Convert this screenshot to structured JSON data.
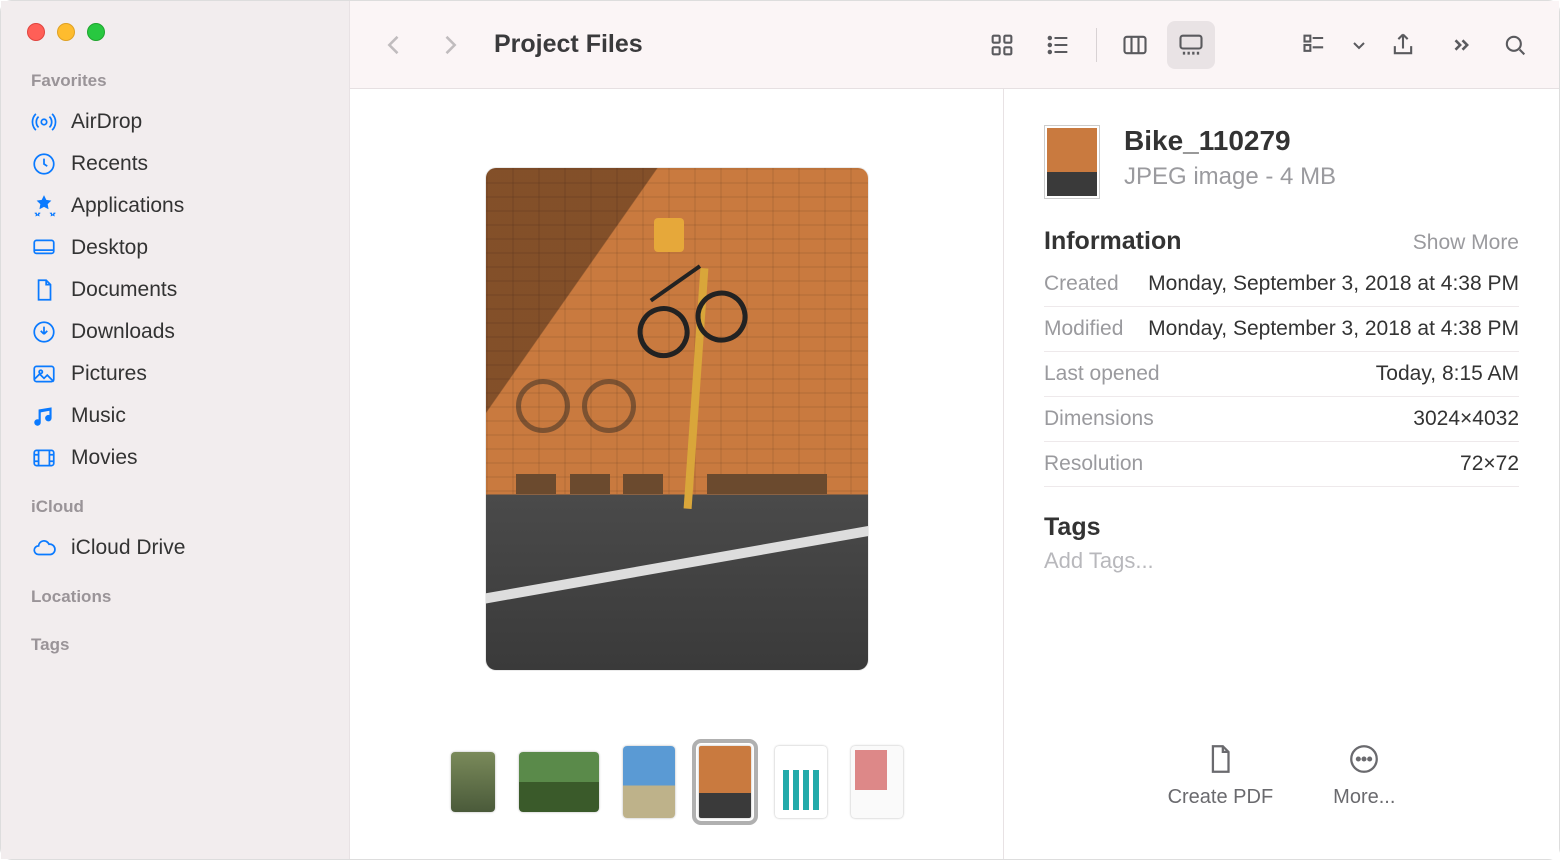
{
  "window": {
    "title": "Project Files"
  },
  "sidebar": {
    "sections": [
      {
        "label": "Favorites",
        "items": [
          {
            "icon": "airdrop",
            "label": "AirDrop"
          },
          {
            "icon": "recents",
            "label": "Recents"
          },
          {
            "icon": "applications",
            "label": "Applications"
          },
          {
            "icon": "desktop",
            "label": "Desktop"
          },
          {
            "icon": "documents",
            "label": "Documents"
          },
          {
            "icon": "downloads",
            "label": "Downloads"
          },
          {
            "icon": "pictures",
            "label": "Pictures"
          },
          {
            "icon": "music",
            "label": "Music"
          },
          {
            "icon": "movies",
            "label": "Movies"
          }
        ]
      },
      {
        "label": "iCloud",
        "items": [
          {
            "icon": "cloud",
            "label": "iCloud Drive"
          }
        ]
      },
      {
        "label": "Locations",
        "items": []
      },
      {
        "label": "Tags",
        "items": []
      }
    ]
  },
  "file": {
    "name": "Bike_110279",
    "subtitle": "JPEG image - 4 MB"
  },
  "info": {
    "heading": "Information",
    "show_more": "Show More",
    "rows": [
      {
        "k": "Created",
        "v": "Monday, September 3, 2018 at 4:38 PM"
      },
      {
        "k": "Modified",
        "v": "Monday, September 3, 2018 at 4:38 PM"
      },
      {
        "k": "Last opened",
        "v": "Today, 8:15 AM"
      },
      {
        "k": "Dimensions",
        "v": "3024×4032"
      },
      {
        "k": "Resolution",
        "v": "72×72"
      }
    ]
  },
  "tags": {
    "heading": "Tags",
    "placeholder": "Add Tags..."
  },
  "quick_actions": {
    "create_pdf": "Create PDF",
    "more": "More..."
  },
  "thumbnails": [
    {
      "id": "t1",
      "kind": "landscape"
    },
    {
      "id": "t2",
      "kind": "landscape"
    },
    {
      "id": "t3",
      "kind": "portrait"
    },
    {
      "id": "t4",
      "kind": "portrait",
      "selected": true
    },
    {
      "id": "t5",
      "kind": "portrait"
    },
    {
      "id": "t6",
      "kind": "portrait"
    }
  ]
}
